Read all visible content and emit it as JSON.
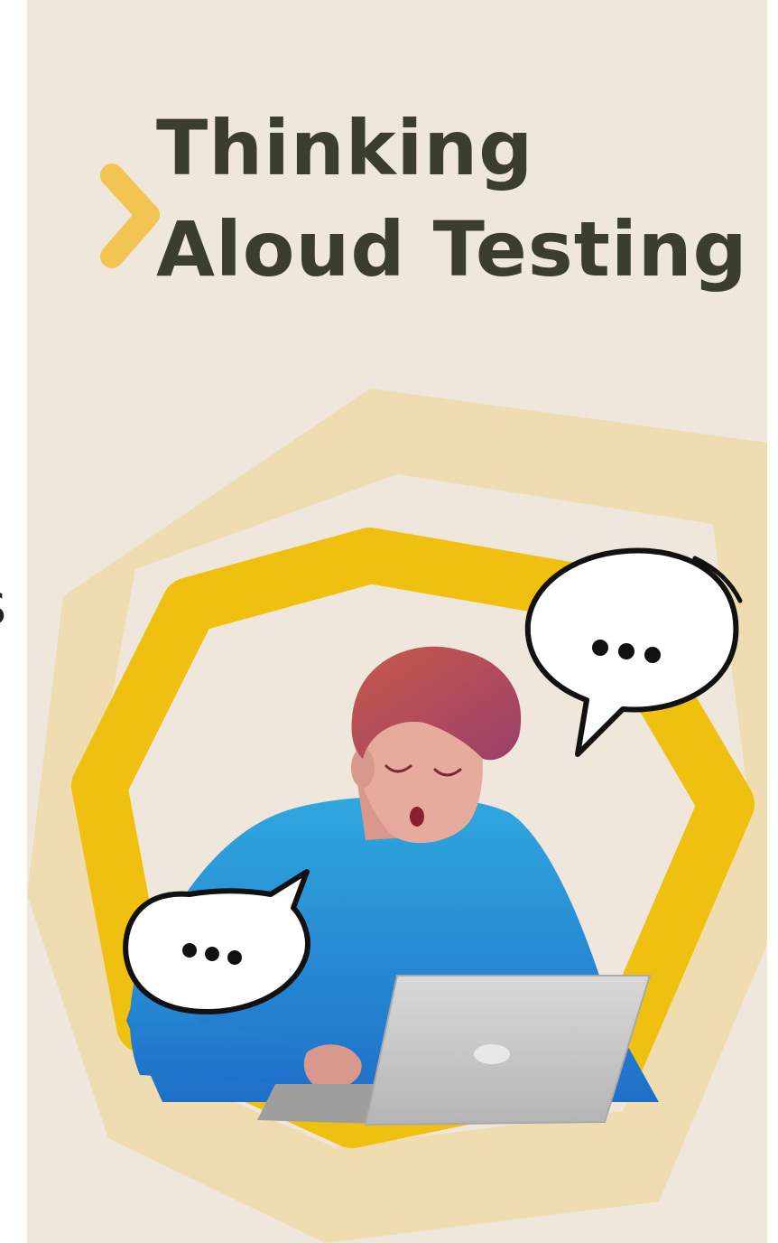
{
  "title": {
    "line1": "Thinking",
    "line2": "Aloud Testing"
  },
  "colors": {
    "background": "#efe6dc",
    "title_text": "#3b3d31",
    "accent_yellow": "#f0c010",
    "pale_yellow": "#efd9a3",
    "shirt_blue": "#2a93d5",
    "laptop_gray": "#c8c8c8"
  },
  "icons": [
    "chevron-right-icon",
    "speech-bubble-icon",
    "laptop-icon"
  ],
  "edge_mark": "s"
}
